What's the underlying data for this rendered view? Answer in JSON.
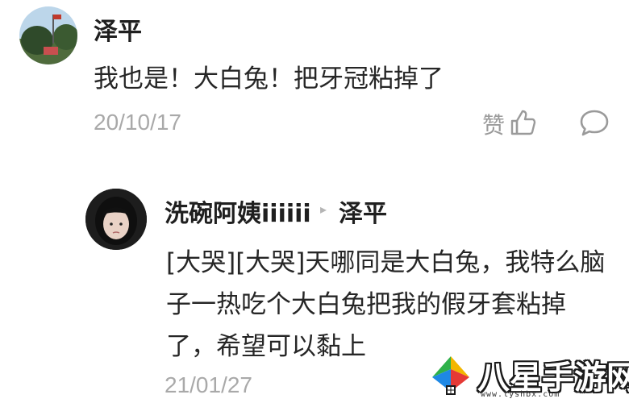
{
  "comment": {
    "username": "泽平",
    "text": "我也是！大白兔！把牙冠粘掉了",
    "date": "20/10/17",
    "like_label": "赞",
    "icons": {
      "like": "thumbs-up-icon",
      "reply": "speech-bubble-icon"
    }
  },
  "reply": {
    "username": "洗碗阿姨iiiiii",
    "arrow": "▸",
    "reply_to": "泽平",
    "text": "[大哭][大哭]天哪同是大白兔，我特么脑子一热吃个大白兔把我的假牙套粘掉了，希望可以黏上",
    "date": "21/01/27"
  },
  "watermark": {
    "title": "八星手游网",
    "url": "www.lyshbx.com"
  },
  "colors": {
    "text": "#262626",
    "muted": "#a9a9a9",
    "background": "#ffffff"
  }
}
